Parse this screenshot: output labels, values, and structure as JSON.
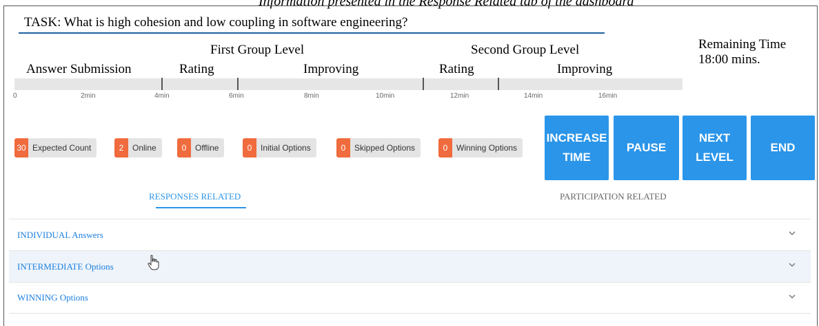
{
  "caption": "Information presented in the Response Related tab of the dashboard",
  "task": "TASK: What is high cohesion and low coupling in software engineering?",
  "timeline": {
    "first_group_label": "First Group Level",
    "second_group_label": "Second Group Level",
    "phases": [
      "Answer Submission",
      "Rating",
      "Improving",
      "Rating",
      "Improving"
    ],
    "ticks": [
      "0",
      "2min",
      "4min",
      "6min",
      "8min",
      "10min",
      "12min",
      "14min",
      "16min"
    ]
  },
  "remaining": {
    "label": "Remaining Time",
    "value": "18:00 mins."
  },
  "badges": [
    {
      "count": "30",
      "label": "Expected Count"
    },
    {
      "count": "2",
      "label": "Online"
    },
    {
      "count": "0",
      "label": "Offline"
    },
    {
      "count": "0",
      "label": "Initial Options"
    },
    {
      "count": "0",
      "label": "Skipped Options"
    },
    {
      "count": "0",
      "label": "Winning Options"
    }
  ],
  "buttons": {
    "increase_time": "INCREASE\nTIME",
    "pause": "PAUSE",
    "next_level": "NEXT\nLEVEL",
    "end": "END"
  },
  "tabs": {
    "responses": "RESPONSES RELATED",
    "participation": "PARTICIPATION RELATED"
  },
  "panels": [
    {
      "title": "INDIVIDUAL Answers"
    },
    {
      "title": "INTERMEDIATE Options"
    },
    {
      "title": "WINNING Options"
    }
  ],
  "colors": {
    "accent": "#2b95e9",
    "badge_count": "#f06b3d",
    "hover_row": "#eef4fa"
  }
}
